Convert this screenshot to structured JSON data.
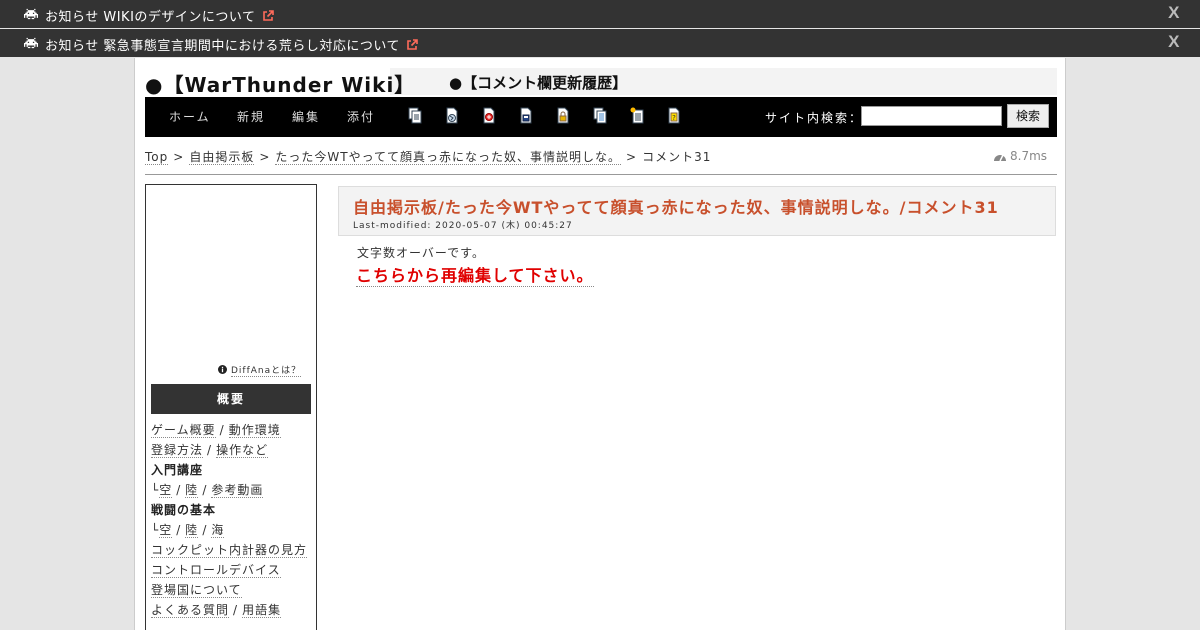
{
  "notices": [
    {
      "icon": "space-invader-icon",
      "text": "お知らせ WIKIのデザインについて",
      "close": "X"
    },
    {
      "icon": "space-invader-icon",
      "text": "お知らせ 緊急事態宣言期間中における荒らし対応について",
      "close": "X"
    }
  ],
  "header": {
    "site_title": "●【WarThunder Wiki】",
    "recent_link": "●【コメント欄更新履歴】"
  },
  "navbar": {
    "items": [
      "ホーム",
      "新規",
      "編集",
      "添付"
    ],
    "tool_icons": [
      "copy-page-icon",
      "diff-icon",
      "backup-icon",
      "save-icon",
      "freeze-icon",
      "list-icon",
      "new-page-icon",
      "help-icon"
    ],
    "search_label": "サイト内検索：",
    "search_value": "",
    "search_button": "検索"
  },
  "breadcrumb": {
    "items": [
      "Top",
      "自由掲示板",
      "たった今WTやってて顔真っ赤になった奴、事情説明しな。",
      "コメント31"
    ],
    "separator": ">",
    "timing": "8.7ms"
  },
  "sidebar": {
    "diffana_link": "DiffAnaとは？",
    "section_title": "概要",
    "menu": {
      "row1": [
        "ゲーム概要",
        "動作環境"
      ],
      "row2": [
        "登録方法",
        "操作など"
      ],
      "heading1": "入門講座",
      "row3_prefix": "└",
      "row3": [
        "空",
        "陸",
        "参考動画"
      ],
      "heading2": "戦闘の基本",
      "row4_prefix": "└",
      "row4": [
        "空",
        "陸",
        "海"
      ],
      "cockpit": "コックピット内計器の見方",
      "controller": "コントロールデバイス",
      "nations": "登場国について",
      "faq": [
        "よくある質問",
        "用語集"
      ],
      "separator": "/"
    }
  },
  "content": {
    "title": "自由掲示板/たった今WTやってて顔真っ赤になった奴、事情説明しな。/コメント31",
    "last_modified": "Last-modified: 2020-05-07 (木) 00:45:27",
    "body": "文字数オーバーです。",
    "edit_link": "こちらから再編集して下さい。"
  },
  "colors": {
    "notice_bg": "#333333",
    "navbar_bg": "#000000",
    "title_color": "#c8502c",
    "edit_link_color": "#e00000",
    "external_link_color": "#ff6b5b"
  }
}
